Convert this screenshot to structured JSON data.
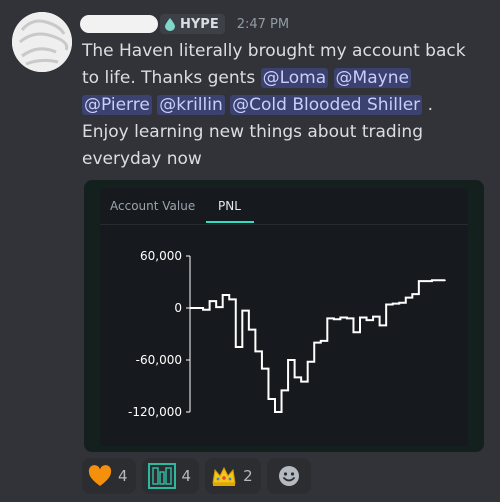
{
  "header": {
    "role_tag": "HYPE",
    "timestamp": "2:47 PM"
  },
  "message": {
    "intro": "The Haven literally brought my account back to life. Thanks gents ",
    "mentions": [
      "@Loma",
      "@Mayne",
      "@Pierre",
      "@krillin",
      "@Cold Blooded Shiller"
    ],
    "outro": " . Enjoy learning new things about trading everyday now"
  },
  "embed": {
    "tabs": [
      {
        "label": "Account Value",
        "active": false
      },
      {
        "label": "PNL",
        "active": true
      }
    ],
    "accent_color": "#2fe0c0"
  },
  "chart_data": {
    "type": "line",
    "title": "",
    "xlabel": "",
    "ylabel": "",
    "ylim": [
      -120000,
      60000
    ],
    "y_ticks": [
      "60,000",
      "0",
      "-60,000",
      "-120,000"
    ],
    "y_tick_values": [
      60000,
      0,
      -60000,
      -120000
    ],
    "grid": false,
    "series": [
      {
        "step": true,
        "x": [
          0,
          1,
          2,
          3,
          4,
          5,
          6,
          7,
          8,
          9,
          10,
          11,
          12,
          13,
          14,
          15,
          16,
          17,
          18,
          19,
          20,
          21,
          22,
          23,
          24,
          25,
          26,
          27,
          28,
          29,
          30,
          31,
          32,
          33,
          34,
          35,
          36,
          37,
          38,
          39
        ],
        "values": [
          0,
          0,
          -2000,
          8000,
          1000,
          15000,
          10000,
          -45000,
          -3000,
          -25000,
          -50000,
          -70000,
          -105000,
          -120000,
          -95000,
          -60000,
          -80000,
          -85000,
          -62000,
          -40000,
          -38000,
          -12000,
          -13000,
          -11000,
          -12000,
          -28000,
          -11000,
          -14000,
          -10000,
          -20000,
          4000,
          5000,
          6000,
          12000,
          16000,
          31000,
          31000,
          32000,
          32000,
          32000
        ]
      }
    ]
  },
  "reactions": [
    {
      "icon": "orange-heart-icon",
      "count": "4",
      "color": "#f4900c"
    },
    {
      "icon": "haven-emoji-icon",
      "count": "4",
      "color": "#2fb8a0"
    },
    {
      "icon": "crown-icon",
      "count": "2",
      "color": "#f5c518"
    }
  ]
}
